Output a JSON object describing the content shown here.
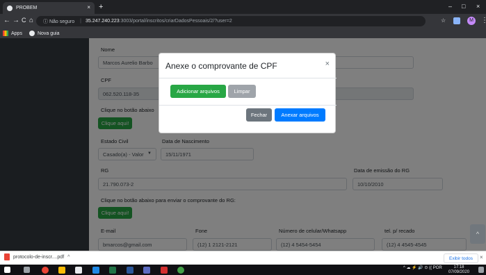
{
  "browser": {
    "tab_title": "PROBEM",
    "tab_close": "×",
    "new_tab": "+",
    "window_controls": {
      "minimize": "–",
      "maximize": "□",
      "close": "×"
    },
    "nav": {
      "back": "←",
      "forward": "→",
      "reload": "C",
      "home": "⌂"
    },
    "security_label": "Não seguro",
    "url_host": "35.247.240.223",
    "url_path": ":3003/portal/inscritos/criarDadosPessoais/2/?user=2",
    "star": "☆",
    "profile_initial": "M",
    "more": "⋮",
    "bookmarks": [
      {
        "label": "Apps",
        "icon": "apps-icon"
      },
      {
        "label": "Nova guia",
        "icon": "globe-icon"
      }
    ]
  },
  "form": {
    "nome_label": "Nome",
    "nome_value": "Marcos Aurelio Barbo",
    "cpf_label": "CPF",
    "cpf_value": "062.520.118-35",
    "clique_label_1": "Clique no botão abaixo",
    "clique_button_1": "Clique aqui!",
    "estado_civil_label": "Estado Civil",
    "estado_civil_value": "Casado(a) - Valor",
    "nascimento_label": "Data de Nascimento",
    "nascimento_value": "15/11/1971",
    "rg_label": "RG",
    "rg_value": "21.790.073-2",
    "emissao_label": "Data de emissão do RG",
    "emissao_value": "10/10/2010",
    "clique_label_2": "Clique no botão abaixo para enviar o comprovante do RG:",
    "clique_button_2": "Clique aqui!",
    "email_label": "E-mail",
    "email_value": "bmarcos@gmail.com",
    "fone_label": "Fone",
    "fone_value": "(12) 1 2121-2121",
    "celular_label": "Número de celular/Whatsapp",
    "celular_value": "(12) 4 5454-5454",
    "recado_label": "tel. p/ recado",
    "recado_value": "(12) 4 4545-4545"
  },
  "modal": {
    "title": "Anexe o comprovante de CPF",
    "close": "×",
    "add_button": "Adicionar arquivos",
    "clear_button": "Limpar",
    "fechar_button": "Fechar",
    "anexar_button": "Anexar arquivos"
  },
  "downloads": {
    "file": "protocolo-de-inscr....pdf",
    "chevron": "^",
    "show_all": "Exibir todos",
    "close": "×"
  },
  "taskbar": {
    "tray_text": "^ ☁ ⚡ 🔊 ⊙ (( POR",
    "tray_sub": "PTB2",
    "time": "17:18",
    "date": "07/09/2020"
  },
  "scroll_top": "^"
}
